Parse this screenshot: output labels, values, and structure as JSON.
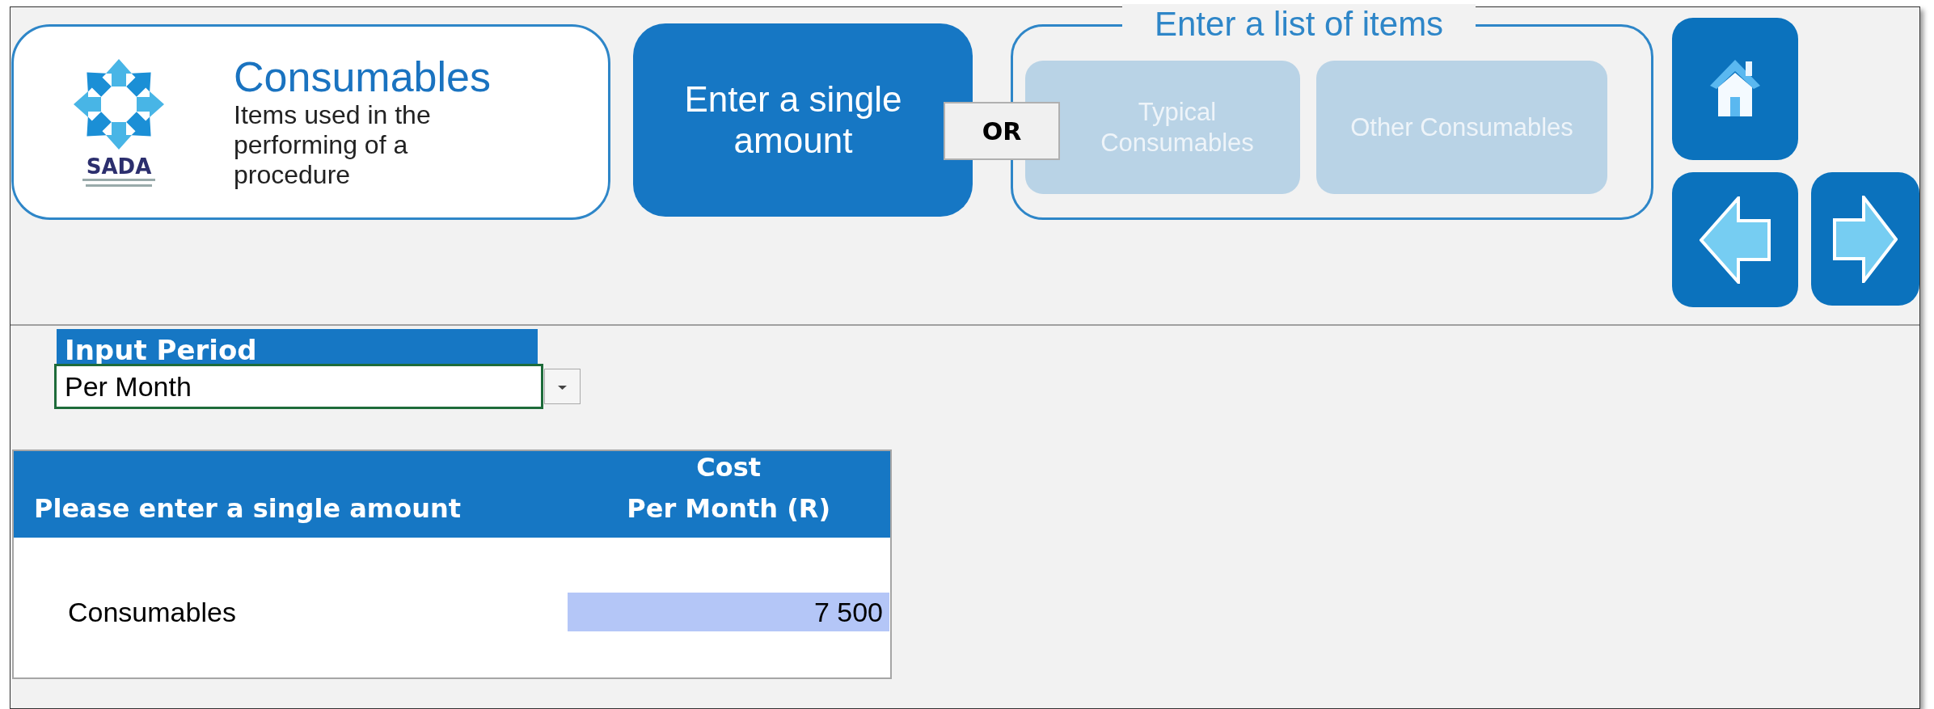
{
  "header": {
    "logo_text": "SADA",
    "title": "Consumables",
    "description": "Items used in the performing of a procedure"
  },
  "single_button": {
    "label": "Enter a single amount",
    "selected": true
  },
  "or_label": "OR",
  "list_group": {
    "legend": "Enter a list of items",
    "buttons": [
      {
        "label": "Typical Consumables",
        "disabled": true
      },
      {
        "label": "Other Consumables",
        "disabled": true
      }
    ]
  },
  "nav_buttons": [
    {
      "kind": "home"
    },
    {
      "kind": "back"
    },
    {
      "kind": "forward"
    }
  ],
  "input_period": {
    "label": "Input Period",
    "value": "Per Month"
  },
  "table": {
    "columns": [
      "Please enter a single amount",
      "Cost\nPer Month (R)"
    ],
    "rows": [
      {
        "cells": [
          "Consumables",
          "7 500"
        ]
      }
    ]
  }
}
